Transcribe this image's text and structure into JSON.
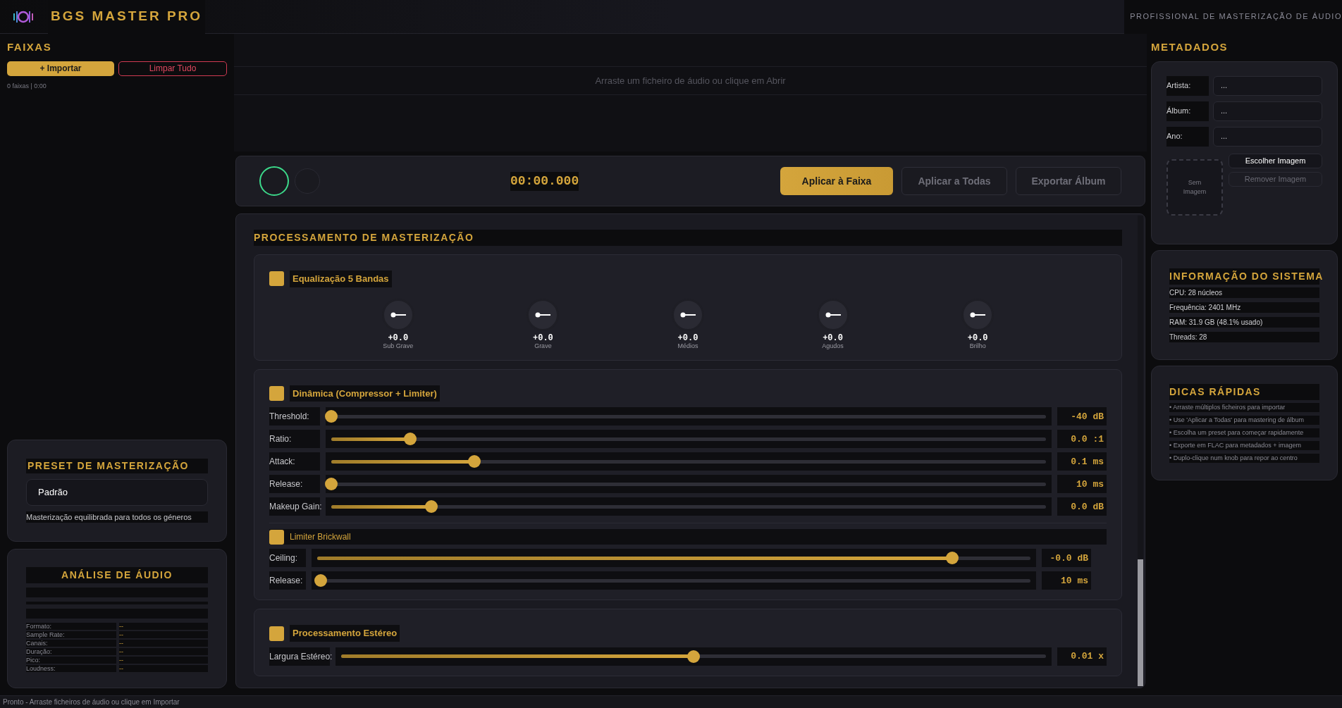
{
  "header": {
    "title": "BGS MASTER PRO",
    "subtitle": "PROFISSIONAL DE MASTERIZAÇÃO DE ÁUDIO"
  },
  "tracks": {
    "title": "FAIXAS",
    "import_button": "+ Importar",
    "clear_button": "Limpar Tudo",
    "summary": "0 faixas | 0:00"
  },
  "preset": {
    "title": "PRESET DE MASTERIZAÇÃO",
    "value": "Padrão",
    "description": "Masterização equilibrada para todos os géneros"
  },
  "analysis": {
    "title": "ANÁLISE DE ÁUDIO",
    "rows": [
      {
        "label": "Formato:",
        "value": "--"
      },
      {
        "label": "Sample Rate:",
        "value": "--"
      },
      {
        "label": "Canais:",
        "value": "--"
      },
      {
        "label": "Duração:",
        "value": "--"
      },
      {
        "label": "Pico:",
        "value": "--"
      },
      {
        "label": "Loudness:",
        "value": "--"
      }
    ]
  },
  "drop_area": {
    "text": "Arraste um ficheiro de áudio ou clique em Abrir"
  },
  "transport": {
    "time": "00:00.000",
    "buttons": [
      {
        "label": "Aplicar à Faixa",
        "disabled": false
      },
      {
        "label": "Aplicar a Todas",
        "disabled": true
      },
      {
        "label": "Exportar Álbum",
        "disabled": true
      }
    ]
  },
  "processing": {
    "title": "PROCESSAMENTO DE MASTERIZAÇÃO",
    "sections": [
      {
        "kind": "knobs",
        "title": "Equalização 5 Bandas",
        "checked": true,
        "knobs": [
          {
            "value": "+0.0",
            "label": "Sub Grave"
          },
          {
            "value": "+0.0",
            "label": "Grave"
          },
          {
            "value": "+0.0",
            "label": "Médios"
          },
          {
            "value": "+0.0",
            "label": "Agudos"
          },
          {
            "value": "+0.0",
            "label": "Brilho"
          }
        ]
      },
      {
        "kind": "sliders",
        "title": "Dinâmica (Compressor + Limiter)",
        "checked": true,
        "sliders": [
          {
            "label": "Threshold:",
            "level": 0,
            "reading": "-40 dB"
          },
          {
            "label": "Ratio:",
            "level": 0.11,
            "reading": "0.0 :1"
          },
          {
            "label": "Attack:",
            "level": 0.2,
            "reading": "0.1 ms"
          },
          {
            "label": "Release:",
            "level": 0,
            "reading": "10 ms"
          },
          {
            "label": "Makeup Gain:",
            "level": 0.14,
            "reading": "0.0 dB"
          }
        ],
        "subsection": {
          "title": "Limiter Brickwall",
          "checked": true,
          "sliders": [
            {
              "label": "Ceiling:",
              "level": 0.89,
              "reading": "-0.0 dB"
            },
            {
              "label": "Release:",
              "level": 0.005,
              "reading": "10 ms"
            }
          ]
        }
      },
      {
        "kind": "sliders",
        "title": "Processamento Estéreo",
        "checked": true,
        "sliders": [
          {
            "label": "Largura Estéreo:",
            "level": 0.5,
            "reading": "0.01 x"
          }
        ]
      }
    ]
  },
  "metadata": {
    "title": "METADADOS",
    "fields": [
      {
        "label": "Artista:",
        "placeholder": "..."
      },
      {
        "label": "Álbum:",
        "placeholder": "..."
      },
      {
        "label": "Ano:",
        "placeholder": "..."
      }
    ],
    "cover_placeholder": "Sem Imagem",
    "choose_button": "Escolher Imagem",
    "remove_button": {
      "label": "Remover Imagem",
      "disabled": true
    }
  },
  "system_info": {
    "title": "INFORMAÇÃO DO SISTEMA",
    "lines": [
      "CPU: 28 núcleos",
      "Frequência: 2401 MHz",
      "RAM: 31.9 GB (48.1% usado)",
      "Threads: 28"
    ]
  },
  "tips": {
    "title": "DICAS RÁPIDAS",
    "items": [
      "• Arraste múltiplos ficheiros para importar",
      "• Use 'Aplicar a Todas' para mastering de álbum",
      "• Escolha um preset para começar rapidamente",
      "• Exporte em FLAC para metadados + imagem",
      "• Duplo-clique num knob para repor ao centro"
    ]
  },
  "status_bar": "Pronto - Arraste ficheiros de áudio ou clique em Importar"
}
